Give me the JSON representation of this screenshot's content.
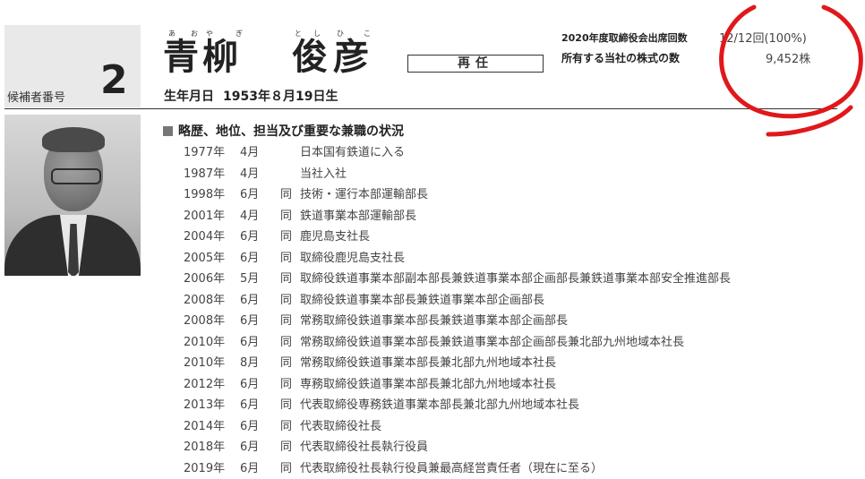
{
  "candidate": {
    "number_label": "候補者番号",
    "number": "2",
    "furigana": [
      "あ",
      "お",
      "や",
      "ぎ",
      "と",
      "し",
      "ひ",
      "こ"
    ],
    "name_parts": [
      "青",
      "柳",
      "俊",
      "彦"
    ],
    "status": "再任",
    "dob_label": "生年月日",
    "dob_value": "1953年８月19日生"
  },
  "stats": {
    "attendance_label": "2020年度取締役会出席回数",
    "attendance_value": "12/12回(100%)",
    "shares_label": "所有する当社の株式の数",
    "shares_value": "9,452株"
  },
  "history_title": "略歴、地位、担当及び重要な兼職の状況",
  "history": [
    {
      "year": "1977年",
      "month": "4月",
      "same": "",
      "text": "日本国有鉄道に入る"
    },
    {
      "year": "1987年",
      "month": "4月",
      "same": "",
      "text": "当社入社"
    },
    {
      "year": "1998年",
      "month": "6月",
      "same": "同",
      "text": "技術・運行本部運輸部長"
    },
    {
      "year": "2001年",
      "month": "4月",
      "same": "同",
      "text": "鉄道事業本部運輸部長"
    },
    {
      "year": "2004年",
      "month": "6月",
      "same": "同",
      "text": "鹿児島支社長"
    },
    {
      "year": "2005年",
      "month": "6月",
      "same": "同",
      "text": "取締役鹿児島支社長"
    },
    {
      "year": "2006年",
      "month": "5月",
      "same": "同",
      "text": "取締役鉄道事業本部副本部長兼鉄道事業本部企画部長兼鉄道事業本部安全推進部長"
    },
    {
      "year": "2008年",
      "month": "6月",
      "same": "同",
      "text": "取締役鉄道事業本部長兼鉄道事業本部企画部長"
    },
    {
      "year": "2008年",
      "month": "6月",
      "same": "同",
      "text": "常務取締役鉄道事業本部長兼鉄道事業本部企画部長"
    },
    {
      "year": "2010年",
      "month": "6月",
      "same": "同",
      "text": "常務取締役鉄道事業本部長兼鉄道事業本部企画部長兼北部九州地域本社長"
    },
    {
      "year": "2010年",
      "month": "8月",
      "same": "同",
      "text": "常務取締役鉄道事業本部長兼北部九州地域本社長"
    },
    {
      "year": "2012年",
      "month": "6月",
      "same": "同",
      "text": "専務取締役鉄道事業本部長兼北部九州地域本社長"
    },
    {
      "year": "2013年",
      "month": "6月",
      "same": "同",
      "text": "代表取締役専務鉄道事業本部長兼北部九州地域本社長"
    },
    {
      "year": "2014年",
      "month": "6月",
      "same": "同",
      "text": "代表取締役社長"
    },
    {
      "year": "2018年",
      "month": "6月",
      "same": "同",
      "text": "代表取締役社長執行役員"
    },
    {
      "year": "2019年",
      "month": "6月",
      "same": "同",
      "text": "代表取締役社長執行役員兼最高経営責任者（現在に至る）"
    }
  ],
  "colors": {
    "annotation": "#e0181b",
    "text": "#333333",
    "panel": "#e9e9e9"
  },
  "icons": {
    "section_marker": "square-bullet-icon"
  }
}
